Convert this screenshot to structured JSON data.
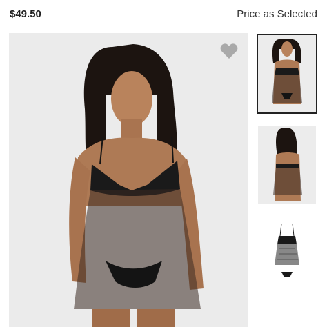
{
  "header": {
    "price": "$49.50",
    "price_note": "Price as Selected"
  },
  "gallery": {
    "main_image": "model-front-photo",
    "favorite_icon": "heart-icon",
    "thumbnails": [
      {
        "image": "model-front-photo",
        "selected": true
      },
      {
        "image": "model-back-photo",
        "selected": false
      },
      {
        "image": "product-flat-photo",
        "selected": false
      }
    ]
  },
  "colors": {
    "background": "#ffffff",
    "image_background": "#ebebeb",
    "heart": "#a9a9a9",
    "selected_border": "#222222"
  }
}
